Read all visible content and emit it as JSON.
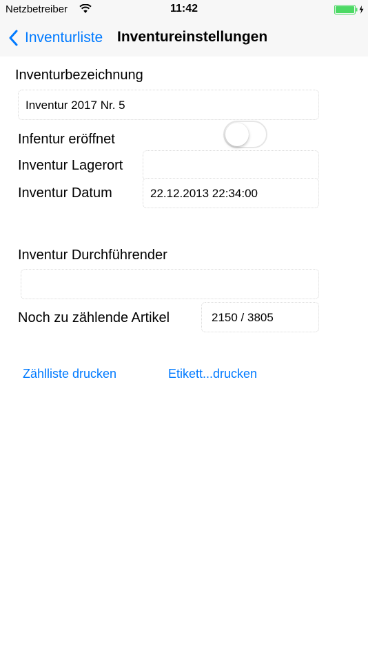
{
  "status": {
    "carrier": "Netzbetreiber",
    "time": "11:42",
    "battery_color": "#4cd964"
  },
  "nav": {
    "back_label": "Inventurliste",
    "title": "Inventureinstellungen"
  },
  "form": {
    "name_label": "Inventurbezeichnung",
    "name_value": "Inventur 2017 Nr. 5",
    "opened_label": "Infentur eröffnet",
    "opened_on": false,
    "location_label": "Inventur Lagerort",
    "location_value": "",
    "date_label": "Inventur Datum",
    "date_value": "22.12.2013 22:34:00",
    "performer_label": "Inventur Durchführender",
    "performer_value": "",
    "remaining_label": "Noch zu zählende Artikel",
    "remaining_value": "2150 / 3805"
  },
  "actions": {
    "print_count_list": "Zählliste drucken",
    "print_labels": "Etikett...drucken"
  },
  "accent_color": "#007aff"
}
